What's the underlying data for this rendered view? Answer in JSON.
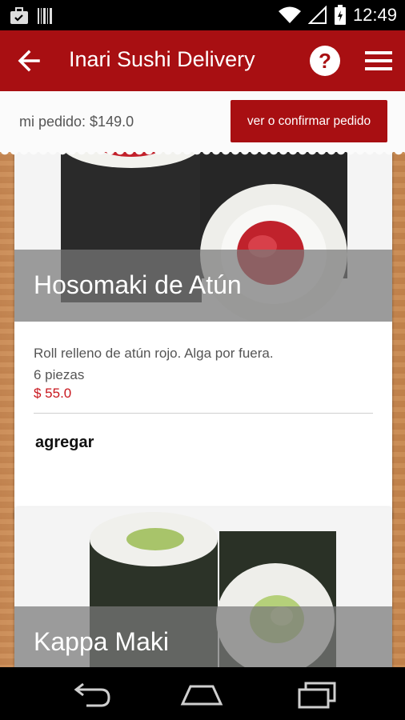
{
  "status_bar": {
    "time": "12:49",
    "icons": [
      "briefcase-notification-icon",
      "barcode-notification-icon",
      "wifi-icon",
      "signal-icon",
      "battery-charging-icon"
    ]
  },
  "action_bar": {
    "title": "Inari Sushi Delivery",
    "icons": [
      "back-arrow-icon",
      "help-icon",
      "hamburger-menu-icon"
    ]
  },
  "order": {
    "total_label": "mi pedido: $149.0",
    "confirm_label": "ver o confirmar pedido"
  },
  "items": [
    {
      "name": "Hosomaki de Atún",
      "description": "Roll relleno de atún rojo. Alga por fuera.",
      "pieces": "6 piezas",
      "price": "$ 55.0",
      "add_label": "agregar"
    },
    {
      "name": "Kappa Maki"
    }
  ],
  "nav_bar": {
    "icons": [
      "back-nav-icon",
      "home-nav-icon",
      "recents-nav-icon"
    ]
  },
  "colors": {
    "brand_red": "#a80f12",
    "price_red": "#c8161d"
  }
}
